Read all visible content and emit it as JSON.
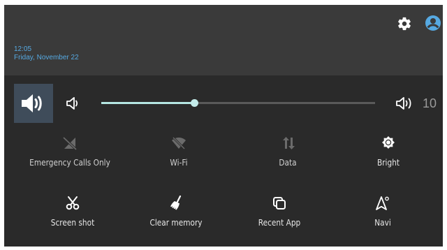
{
  "colors": {
    "panel_bg": "#2a2a2a",
    "header_bg": "#3a3a3a",
    "accent_blue": "#56a9e2",
    "slider_fill": "#b5e6e2",
    "icon_active": "#ffffff",
    "icon_inactive": "#6b6b6b"
  },
  "header": {
    "time": "12:05",
    "date": "Friday, November 22",
    "icons": [
      "gear-icon",
      "account-circle-icon"
    ]
  },
  "volume": {
    "level": 10,
    "fraction": 0.34,
    "level_label": "10",
    "icons": [
      "speaker-loud-icon",
      "speaker-low-icon",
      "speaker-high-icon"
    ]
  },
  "quick_settings": [
    {
      "key": "emergency",
      "label": "Emergency Calls Only",
      "icon": "signal-off-icon",
      "active": false
    },
    {
      "key": "wifi",
      "label": "Wi-Fi",
      "icon": "wifi-off-icon",
      "active": false
    },
    {
      "key": "data",
      "label": "Data",
      "icon": "data-arrows-icon",
      "active": false
    },
    {
      "key": "bright",
      "label": "Bright",
      "icon": "brightness-icon",
      "active": true
    },
    {
      "key": "screenshot",
      "label": "Screen shot",
      "icon": "scissors-icon",
      "active": true
    },
    {
      "key": "clear_memory",
      "label": "Clear memory",
      "icon": "broom-icon",
      "active": true
    },
    {
      "key": "recent_app",
      "label": "Recent App",
      "icon": "recent-apps-icon",
      "active": true
    },
    {
      "key": "navi",
      "label": "Navi",
      "icon": "navigation-icon",
      "active": true
    }
  ]
}
